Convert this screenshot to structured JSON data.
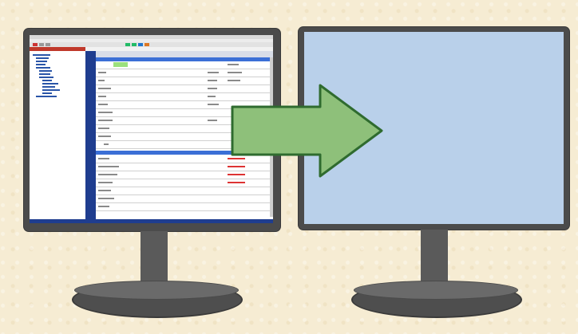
{
  "scene": {
    "left_monitor": {
      "state": "application-on-screen",
      "screen_content": "spreadsheet-app"
    },
    "right_monitor": {
      "state": "blank"
    },
    "arrow": {
      "direction": "right"
    }
  },
  "colors": {
    "background": "#f6ecd3",
    "bezel": "#4b4b4b",
    "blank_screen": "#b9d0ea",
    "arrow_fill": "#8ec07a",
    "arrow_stroke": "#2f6b2f",
    "app_accent_blue": "#1f3d8f",
    "app_section_blue": "#3b6fd6"
  }
}
